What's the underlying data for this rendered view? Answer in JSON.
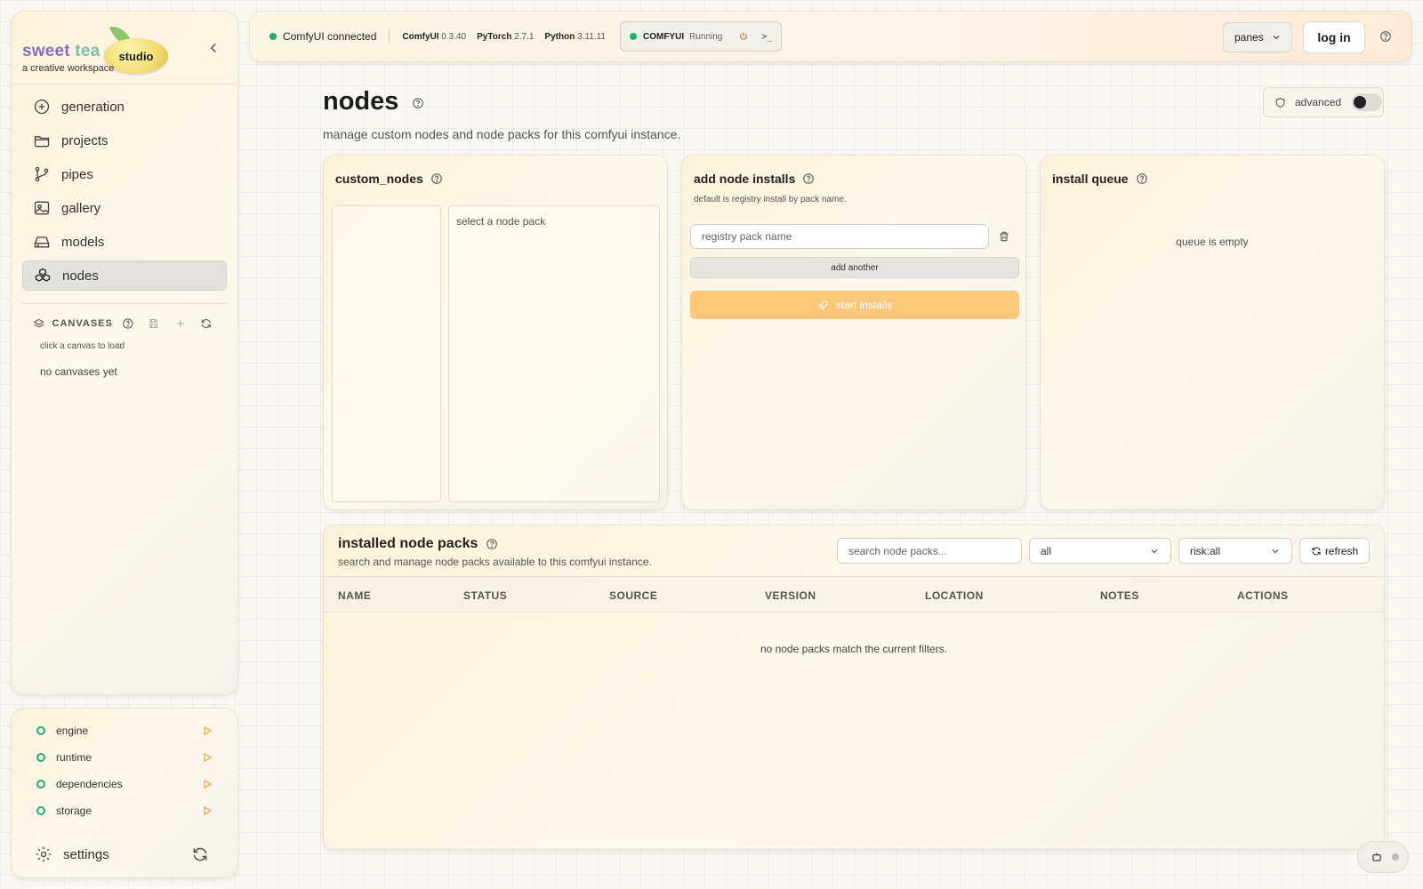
{
  "brand": {
    "sweet": "sweet",
    "tea": "tea",
    "badge": "studio",
    "tagline": "a creative workspace"
  },
  "nav": {
    "items": [
      {
        "label": "generation",
        "icon": "plus-circle-icon"
      },
      {
        "label": "projects",
        "icon": "folder-icon"
      },
      {
        "label": "pipes",
        "icon": "git-branch-icon"
      },
      {
        "label": "gallery",
        "icon": "image-icon"
      },
      {
        "label": "models",
        "icon": "hard-drive-icon"
      },
      {
        "label": "nodes",
        "icon": "boxes-icon",
        "active": true
      }
    ]
  },
  "canvases": {
    "title": "CANVASES",
    "hint": "click a canvas to load",
    "empty": "no canvases yet"
  },
  "system": {
    "items": [
      {
        "label": "engine",
        "status": "ok"
      },
      {
        "label": "runtime",
        "status": "ok"
      },
      {
        "label": "dependencies",
        "status": "ok"
      },
      {
        "label": "storage",
        "status": "ok"
      }
    ],
    "settings_label": "settings"
  },
  "topbar": {
    "connection": "ComfyUI connected",
    "versions": [
      {
        "name": "ComfyUI",
        "value": "0.3.40"
      },
      {
        "name": "PyTorch",
        "value": "2.7.1"
      },
      {
        "name": "Python",
        "value": "3.11.11"
      }
    ],
    "comfy_label": "COMFYUI",
    "comfy_state": "Running",
    "terminal_glyph": ">_",
    "panes_label": "panes",
    "login_label": "log in"
  },
  "page": {
    "title": "nodes",
    "subtitle": "manage custom nodes and node packs for this comfyui instance.",
    "advanced_label": "advanced",
    "advanced_enabled": false
  },
  "custom_nodes": {
    "title": "custom_nodes",
    "placeholder": "select a node pack"
  },
  "add_installs": {
    "title": "add node installs",
    "hint": "default is registry install by pack name.",
    "input_placeholder": "registry pack name",
    "add_another_label": "add another",
    "start_label": "start installs"
  },
  "install_queue": {
    "title": "install queue",
    "empty": "queue is empty"
  },
  "installed": {
    "title": "installed node packs",
    "subtitle": "search and manage node packs available to this comfyui instance.",
    "search_placeholder": "search node packs...",
    "status_filter": "all",
    "risk_filter": "risk:all",
    "refresh_label": "refresh",
    "columns": [
      "NAME",
      "STATUS",
      "SOURCE",
      "VERSION",
      "LOCATION",
      "NOTES",
      "ACTIONS"
    ],
    "empty": "no node packs match the current filters."
  },
  "colors": {
    "accent": "#fbc77a",
    "status_ok": "#1fae78",
    "warn": "#f0a020",
    "power": "#e06060"
  }
}
